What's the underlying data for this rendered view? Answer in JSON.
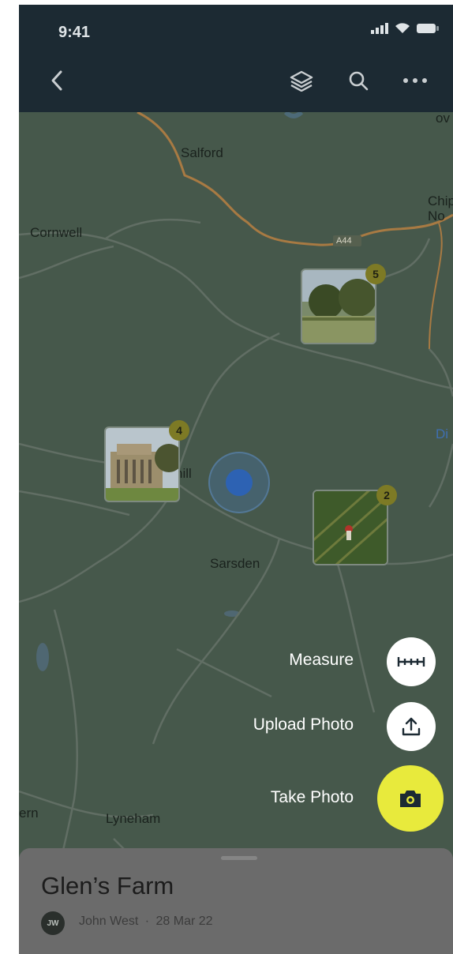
{
  "status_bar": {
    "time": "9:41"
  },
  "toolbar": {
    "icons": [
      "back-chevron-icon",
      "layers-icon",
      "search-icon",
      "more-horizontal-icon"
    ]
  },
  "map": {
    "places": [
      "Salford",
      "Cornwell",
      "A44",
      "Chip No",
      "ov",
      "Di",
      "hill",
      "Sarsden",
      "ern",
      "Lyneham"
    ],
    "clusters": [
      {
        "count": "5",
        "subject": "trees-photo"
      },
      {
        "count": "4",
        "subject": "manor-house-photo"
      },
      {
        "count": "2",
        "subject": "field-photo"
      }
    ]
  },
  "actions": {
    "measure_label": "Measure",
    "upload_label": "Upload Photo",
    "take_label": "Take Photo"
  },
  "sheet": {
    "title": "Glen’s Farm",
    "avatar_initials": "JW",
    "author": "John West",
    "separator": "·",
    "date": "28 Mar 22"
  },
  "colors": {
    "header": "#1c2a33",
    "map_overlay": "#46584b",
    "accent_yellow": "#e8ea3c",
    "location_dot": "#2d62b3"
  }
}
